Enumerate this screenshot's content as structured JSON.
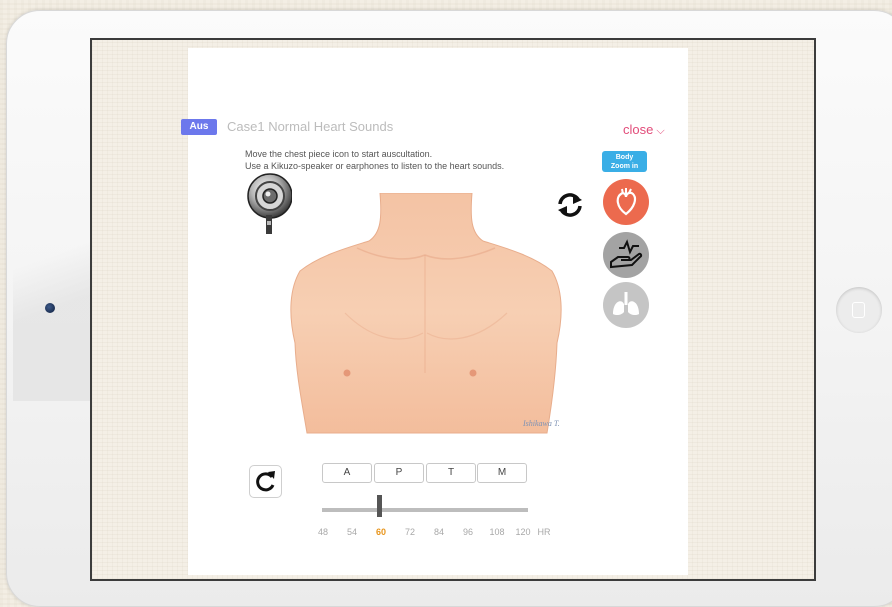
{
  "app": {
    "badge": "Aus",
    "title": "Case1 Normal Heart Sounds",
    "close_label": "close"
  },
  "instructions": {
    "line1": "Move the chest piece icon to start auscultation.",
    "line2": "Use a Kikuzo-speaker or earphones to listen to the heart sounds."
  },
  "zoom_button": {
    "line1": "Body",
    "line2": "Zoom in"
  },
  "modes": [
    {
      "name": "heart",
      "icon": "heart-icon",
      "color": "#ec6a4e"
    },
    {
      "name": "pulse",
      "icon": "hand-pulse-icon",
      "color": "#a3a3a3"
    },
    {
      "name": "lungs",
      "icon": "lungs-icon",
      "color": "#c5c5c5"
    }
  ],
  "illustration": {
    "signature": "Ishikawa T."
  },
  "tabs": [
    "A",
    "P",
    "T",
    "M"
  ],
  "heart_rate": {
    "ticks": [
      "48",
      "54",
      "60",
      "72",
      "84",
      "96",
      "108",
      "120"
    ],
    "unit": "HR",
    "selected": "60"
  }
}
